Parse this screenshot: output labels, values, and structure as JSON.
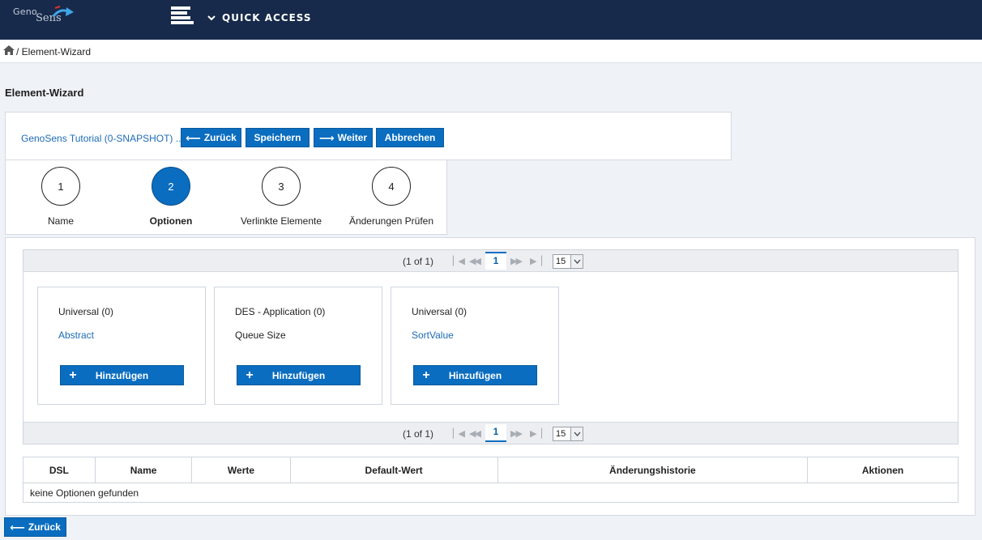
{
  "brand": {
    "logo_top": "Geno",
    "logo_bottom": "Sens"
  },
  "topnav": {
    "quick_access": "QUICK ACCESS"
  },
  "breadcrumb": {
    "current": "/ Element-Wizard"
  },
  "page": {
    "title": "Element-Wizard"
  },
  "toolbar": {
    "project_link": "GenoSens Tutorial (0-SNAPSHOT) ...",
    "back": "Zurück",
    "save": "Speichern",
    "next": "Weiter",
    "cancel": "Abbrechen"
  },
  "steps": [
    {
      "num": "1",
      "label": "Name",
      "active": false
    },
    {
      "num": "2",
      "label": "Optionen",
      "active": true
    },
    {
      "num": "3",
      "label": "Verlinkte Elemente",
      "active": false
    },
    {
      "num": "4",
      "label": "Änderungen Prüfen",
      "active": false
    }
  ],
  "pager": {
    "count": "(1 of 1)",
    "page": "1",
    "rows_per_page": "15"
  },
  "cards": [
    {
      "title": "Universal (0)",
      "item": "Abstract",
      "item_is_link": true,
      "button": "Hinzufügen"
    },
    {
      "title": "DES - Application (0)",
      "item": "Queue Size",
      "item_is_link": false,
      "button": "Hinzufügen"
    },
    {
      "title": "Universal (0)",
      "item": "SortValue",
      "item_is_link": true,
      "button": "Hinzufügen"
    }
  ],
  "table": {
    "columns": [
      "DSL",
      "Name",
      "Werte",
      "Default-Wert",
      "Änderungshistorie",
      "Aktionen"
    ],
    "empty_message": "keine Optionen gefunden"
  },
  "footer": {
    "back": "Zurück"
  },
  "colors": {
    "header_bg": "#172a4b",
    "primary": "#0a6dbf",
    "link": "#1d6bb5"
  }
}
